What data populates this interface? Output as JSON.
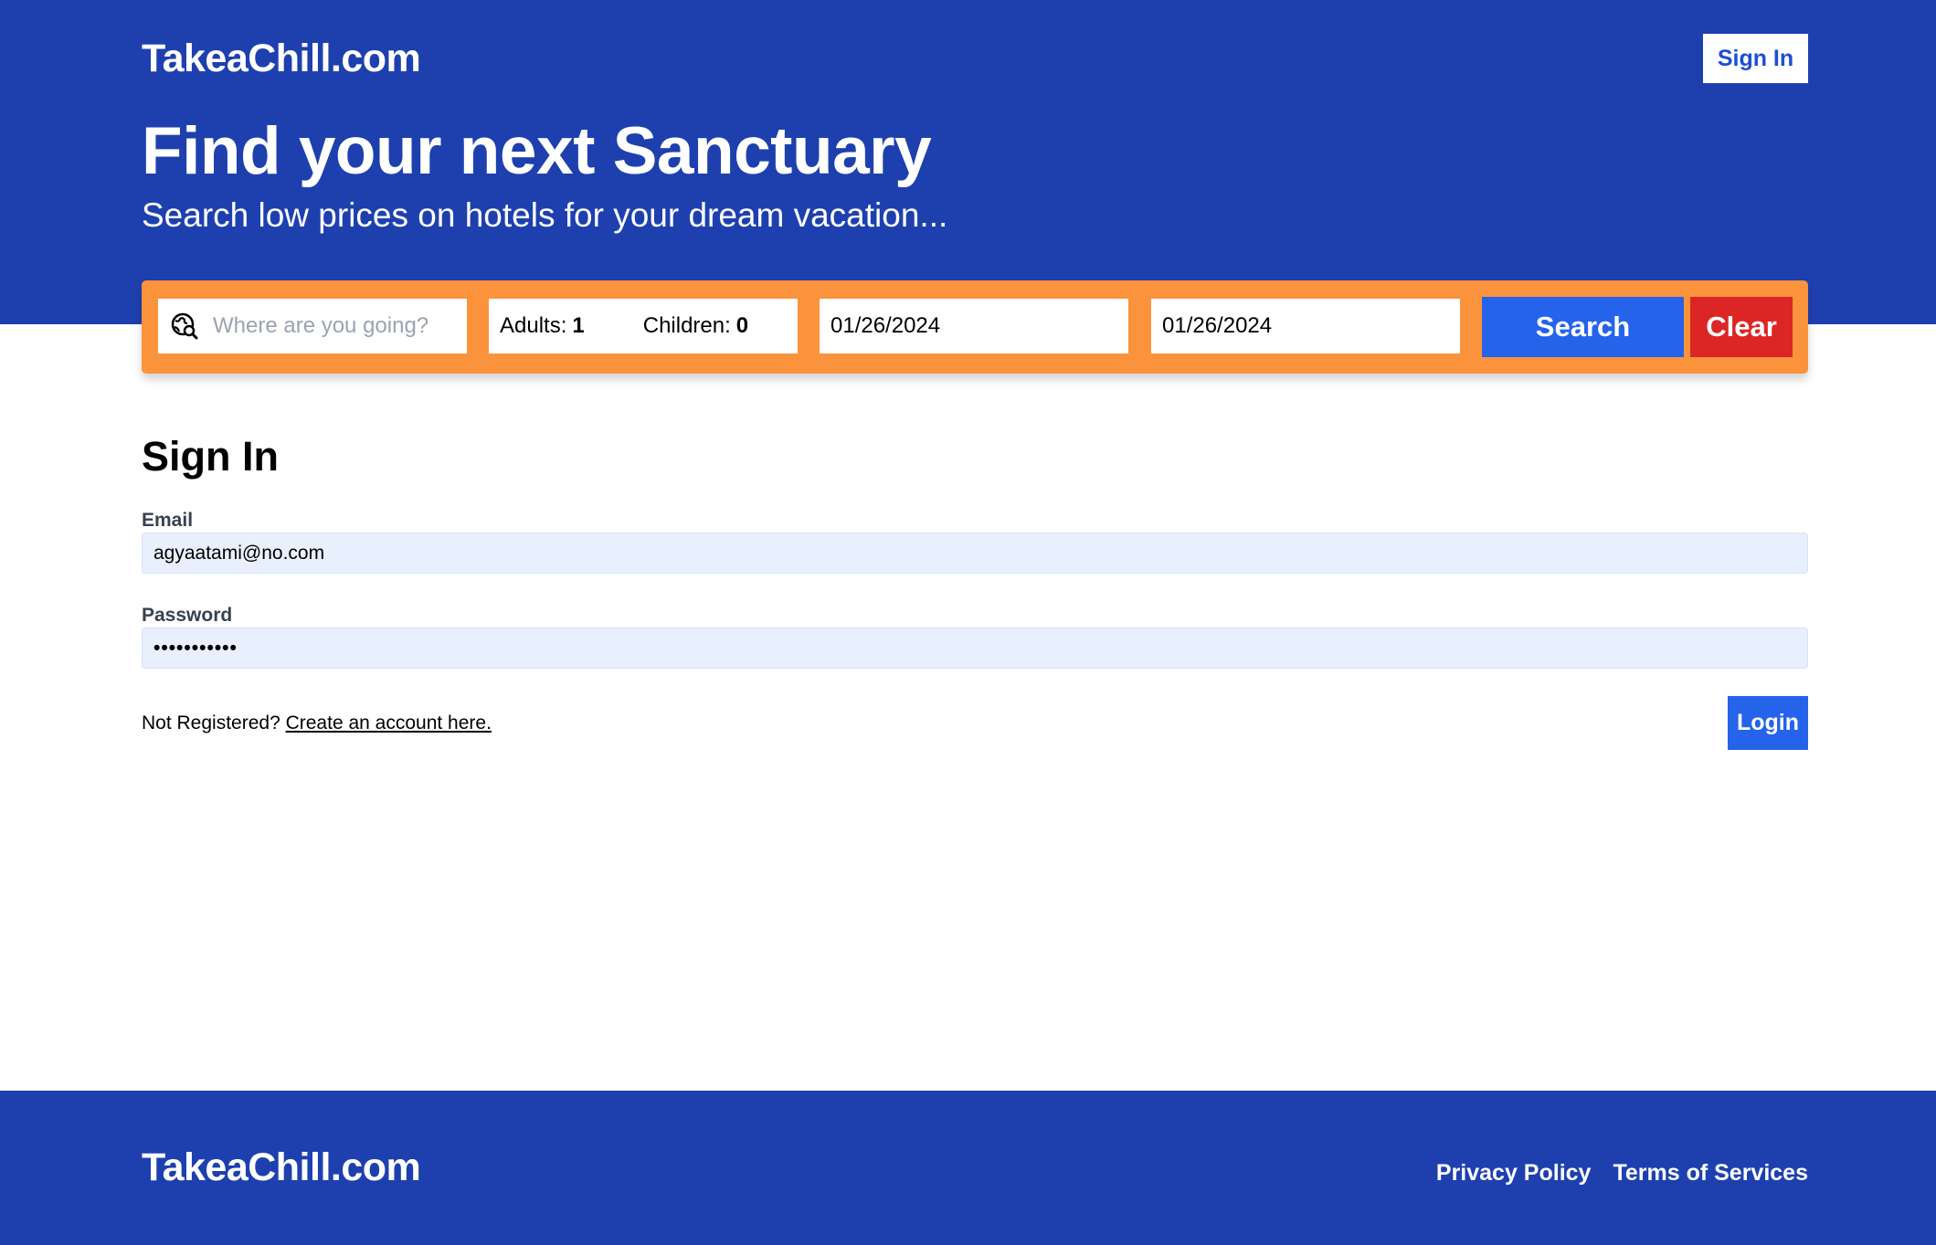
{
  "header": {
    "brand": "TakeaChill.com",
    "sign_in_label": "Sign In"
  },
  "hero": {
    "title": "Find your next Sanctuary",
    "subtitle": "Search low prices on hotels for your dream vacation..."
  },
  "search": {
    "destination_placeholder": "Where are you going?",
    "adults_label": "Adults:",
    "adults_value": "1",
    "children_label": "Children:",
    "children_value": "0",
    "check_in": "01/26/2024",
    "check_out": "01/26/2024",
    "search_label": "Search",
    "clear_label": "Clear"
  },
  "form": {
    "title": "Sign In",
    "email_label": "Email",
    "email_value": "agyaatami@no.com",
    "password_label": "Password",
    "password_value": "•••••••••••",
    "not_registered": "Not Registered? ",
    "create_account_link": "Create an account here.",
    "login_label": "Login"
  },
  "footer": {
    "brand": "TakeaChill.com",
    "links": [
      "Privacy Policy",
      "Terms of Services"
    ]
  },
  "colors": {
    "primary": "#1e40af",
    "button_blue": "#2563eb",
    "search_bar": "#fb923c",
    "clear_red": "#dc2626",
    "input_bg": "#e8f0fe"
  },
  "icons": {
    "destination": "globe-search-icon"
  }
}
